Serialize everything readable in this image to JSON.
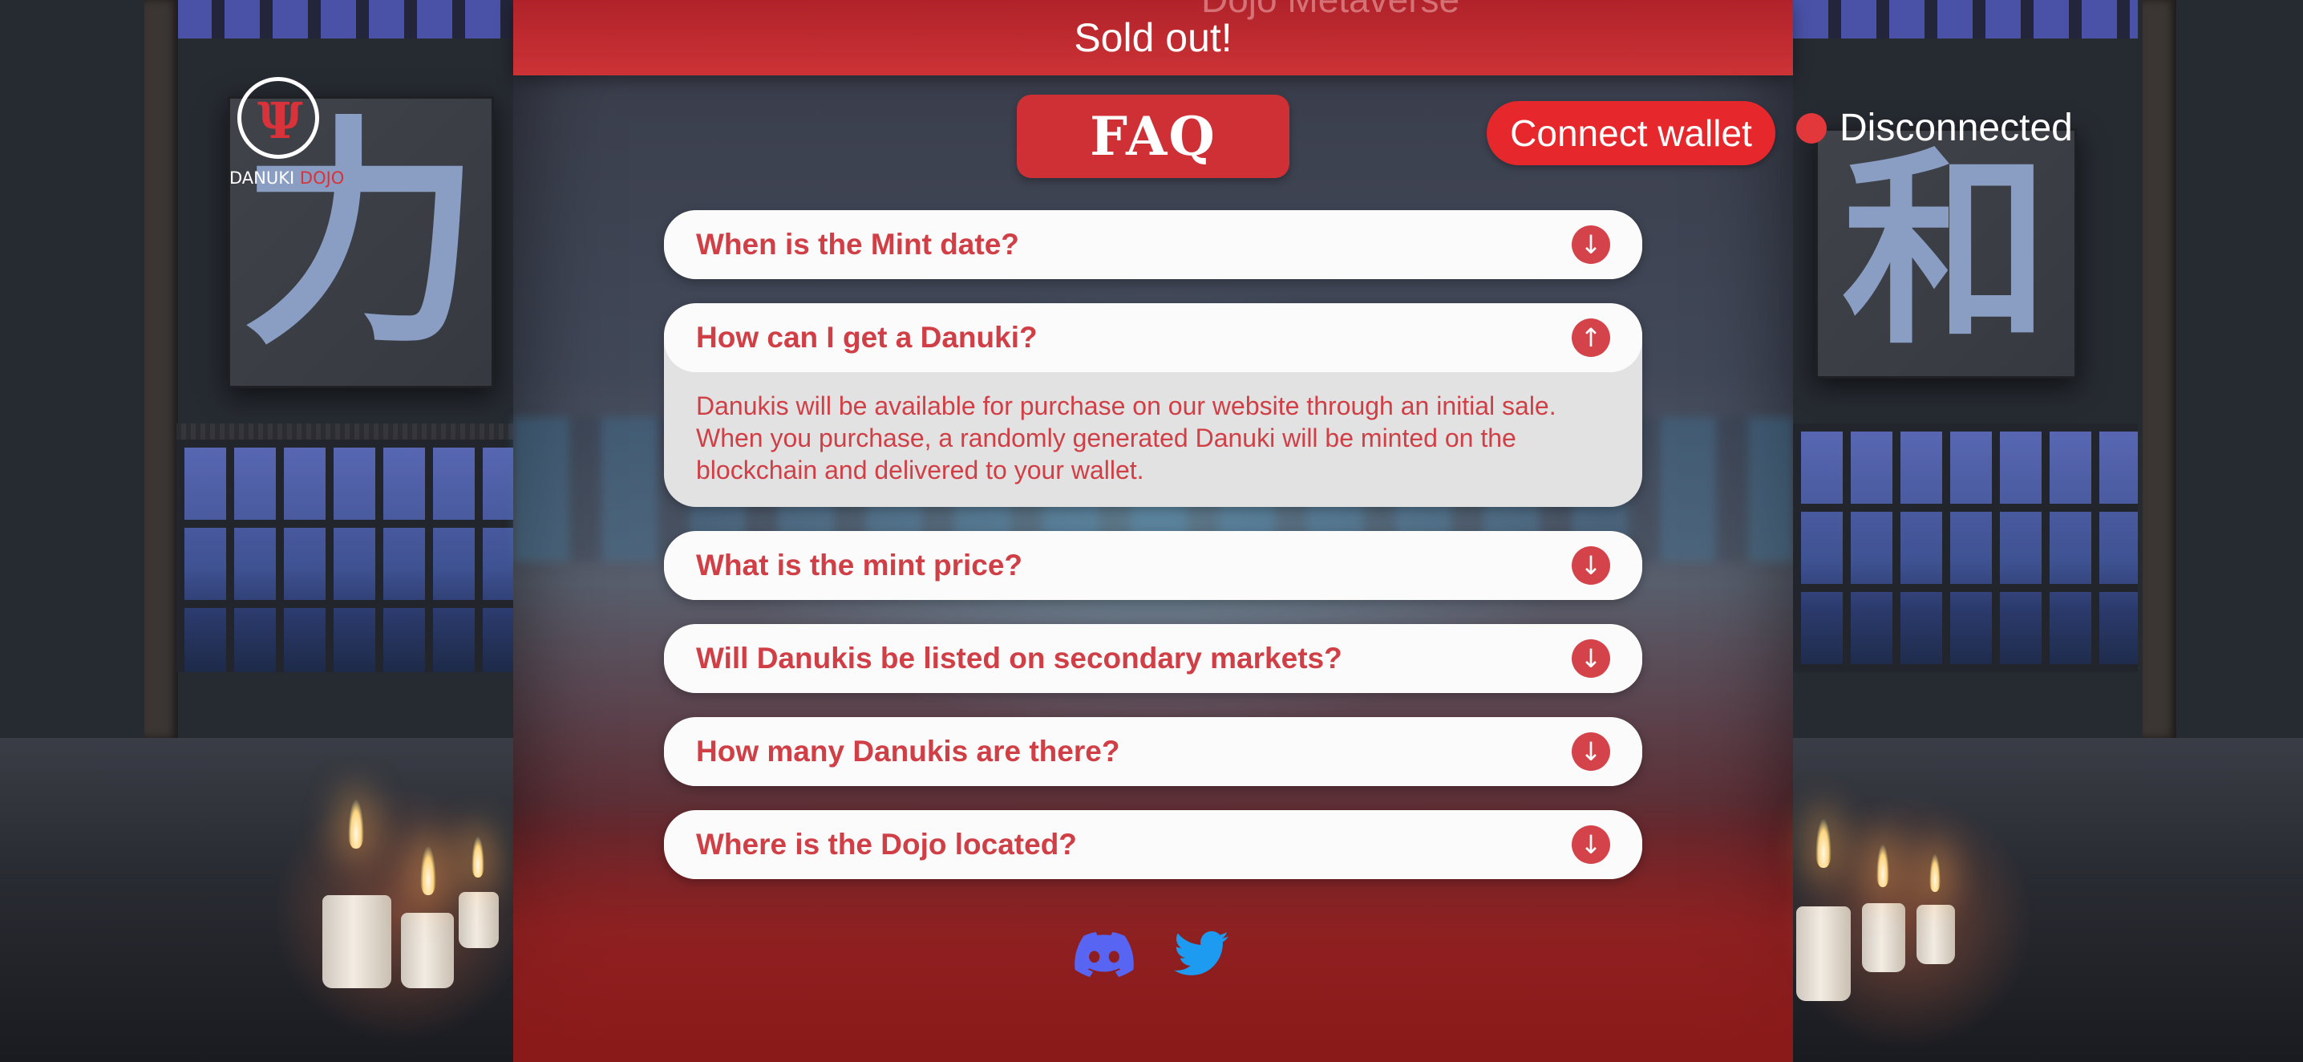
{
  "header": {
    "ghost_title": "Dojo Metaverse",
    "banner": "Sold out!"
  },
  "logo": {
    "name_left": "DANUKI",
    "name_right": "DOJO"
  },
  "decor": {
    "kanji_left": "力",
    "kanji_right": "和"
  },
  "nav": {
    "faq_label": "FAQ",
    "connect_label": "Connect wallet",
    "status_label": "Disconnected",
    "status_color": "#e2383c"
  },
  "faq": {
    "items": [
      {
        "question": "When is the Mint date?",
        "expanded": false
      },
      {
        "question": "How can I get a Danuki?",
        "expanded": true,
        "answer": "Danukis will be available for purchase on our website through an initial sale. When you purchase, a randomly generated Danuki will be minted on the blockchain and delivered to your wallet."
      },
      {
        "question": "What is the mint price?",
        "expanded": false
      },
      {
        "question": "Will Danukis be listed on secondary markets?",
        "expanded": false
      },
      {
        "question": "How many Danukis are there?",
        "expanded": false
      },
      {
        "question": "Where is the Dojo located?",
        "expanded": false
      }
    ]
  },
  "icons": {
    "expand": "arrow-down-icon",
    "collapse": "arrow-up-icon",
    "discord": "discord-icon",
    "twitter": "twitter-icon"
  },
  "colors": {
    "accent": "#cf3035",
    "question_text": "#d03f46",
    "discord": "#5865f2",
    "twitter": "#1d9bf0"
  }
}
